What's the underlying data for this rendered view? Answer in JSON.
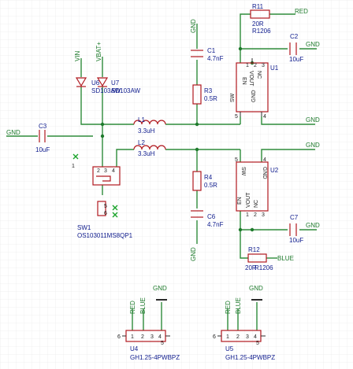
{
  "nets": {
    "gnd": "GND",
    "vin": "VIN",
    "vbat": "VBAT+",
    "red": "RED",
    "blue": "BLUE"
  },
  "parts": {
    "r11": {
      "ref": "R11",
      "value": "20R",
      "package": "R1206"
    },
    "r12": {
      "ref": "R12",
      "value": "20R",
      "package": "R1206"
    },
    "r3": {
      "ref": "R3",
      "value": "0.5R"
    },
    "r4": {
      "ref": "R4",
      "value": "0.5R"
    },
    "c1": {
      "ref": "C1",
      "value": "4.7nF"
    },
    "c2": {
      "ref": "C2",
      "value": "10uF"
    },
    "c3": {
      "ref": "C3",
      "value": "10uF"
    },
    "c6": {
      "ref": "C6",
      "value": "4.7nF"
    },
    "c7": {
      "ref": "C7",
      "value": "10uF"
    },
    "l1": {
      "ref": "L1",
      "value": "3.3uH"
    },
    "l2": {
      "ref": "L2",
      "value": "3.3uH"
    },
    "u6": {
      "ref": "U6",
      "value": "SD103AW"
    },
    "u7": {
      "ref": "U7",
      "value": "SD103AW"
    },
    "u1": {
      "ref": "U1",
      "pins": {
        "en": "EN",
        "vout": "VOUT",
        "nc": "NC",
        "sw": "SW",
        "gnd": "GND"
      }
    },
    "u2": {
      "ref": "U2",
      "pins": {
        "sw": "SW",
        "gnd": "GND",
        "en": "EN",
        "vout": "VOUT",
        "nc": "NC"
      }
    },
    "sw1": {
      "ref": "SW1",
      "value": "OS103011MS8QP1"
    },
    "u4": {
      "ref": "U4",
      "value": "GH1.25-4PWBPZ"
    },
    "u5": {
      "ref": "U5",
      "value": "GH1.25-4PWBPZ"
    }
  },
  "pin_numbers": {
    "one": "1",
    "two": "2",
    "three": "3",
    "four": "4",
    "five": "5",
    "six": "6"
  }
}
